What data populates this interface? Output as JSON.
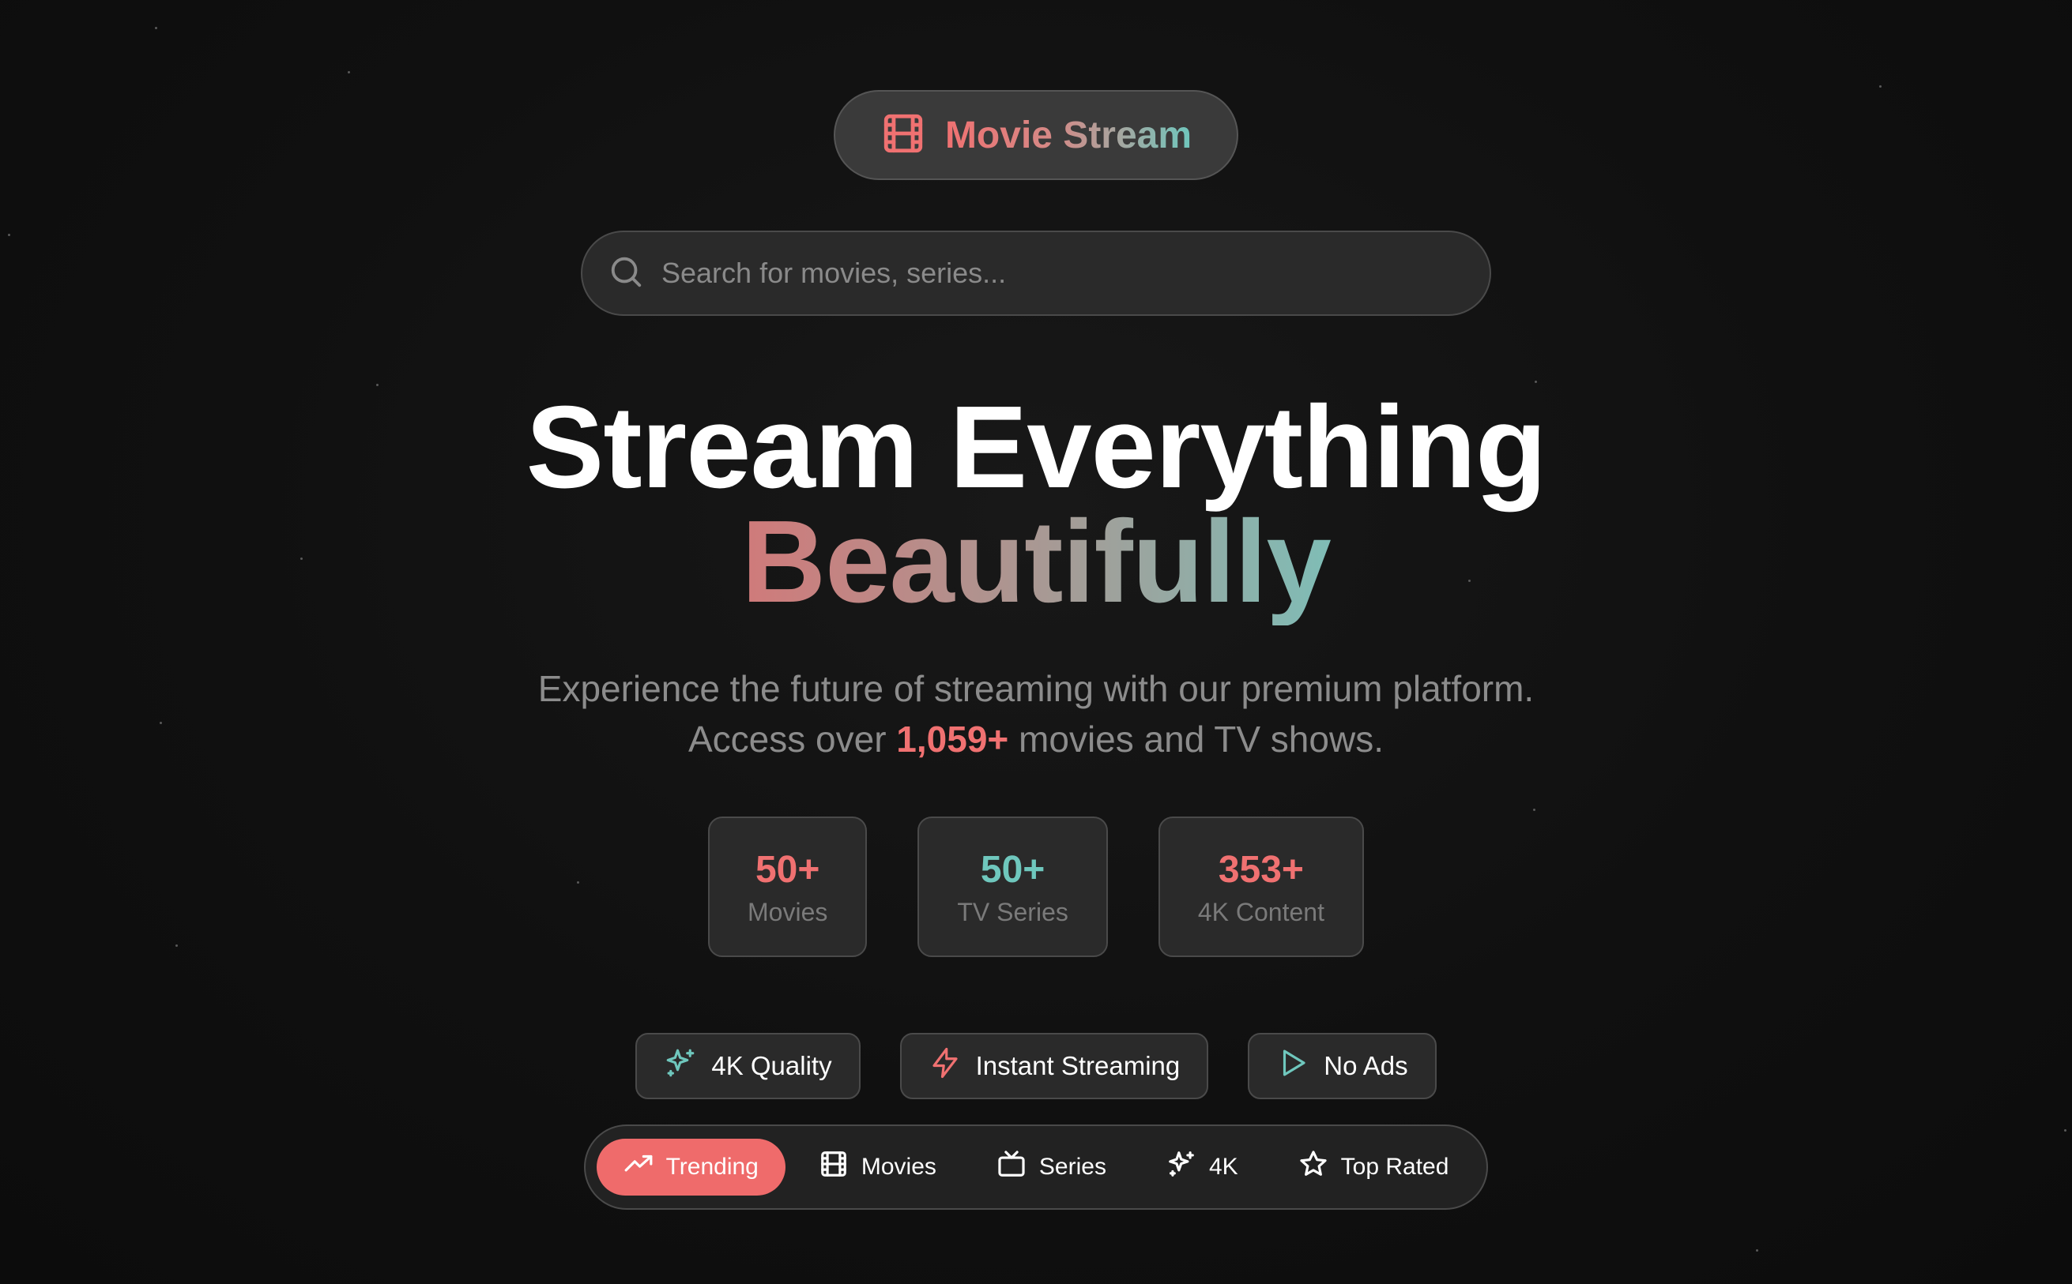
{
  "brand": {
    "name": "Movie Stream",
    "icon": "film-icon"
  },
  "search": {
    "placeholder": "Search for movies, series..."
  },
  "hero": {
    "line1": "Stream Everything",
    "line2": "Beautifully",
    "subtitle_line1": "Experience the future of streaming with our premium platform.",
    "subtitle_pre": "Access over ",
    "subtitle_highlight": "1,059+",
    "subtitle_post": " movies and TV shows."
  },
  "stats": [
    {
      "value": "50+",
      "label": "Movies",
      "color": "#f07171"
    },
    {
      "value": "50+",
      "label": "TV Series",
      "color": "#6fc7bd"
    },
    {
      "value": "353+",
      "label": "4K Content",
      "color": "#f07171"
    }
  ],
  "features": [
    {
      "label": "4K Quality",
      "icon": "sparkles-icon",
      "icon_color": "#6fc7bd"
    },
    {
      "label": "Instant Streaming",
      "icon": "lightning-icon",
      "icon_color": "#f07171"
    },
    {
      "label": "No Ads",
      "icon": "play-icon",
      "icon_color": "#6fc7bd"
    }
  ],
  "tabs": [
    {
      "label": "Trending",
      "icon": "trending-up-icon",
      "active": true
    },
    {
      "label": "Movies",
      "icon": "film-icon",
      "active": false
    },
    {
      "label": "Series",
      "icon": "tv-icon",
      "active": false
    },
    {
      "label": "4K",
      "icon": "sparkles-icon",
      "active": false
    },
    {
      "label": "Top Rated",
      "icon": "star-icon",
      "active": false
    }
  ],
  "colors": {
    "accent": "#f07171",
    "teal": "#6fc7bd",
    "background": "#0f0f0f"
  }
}
